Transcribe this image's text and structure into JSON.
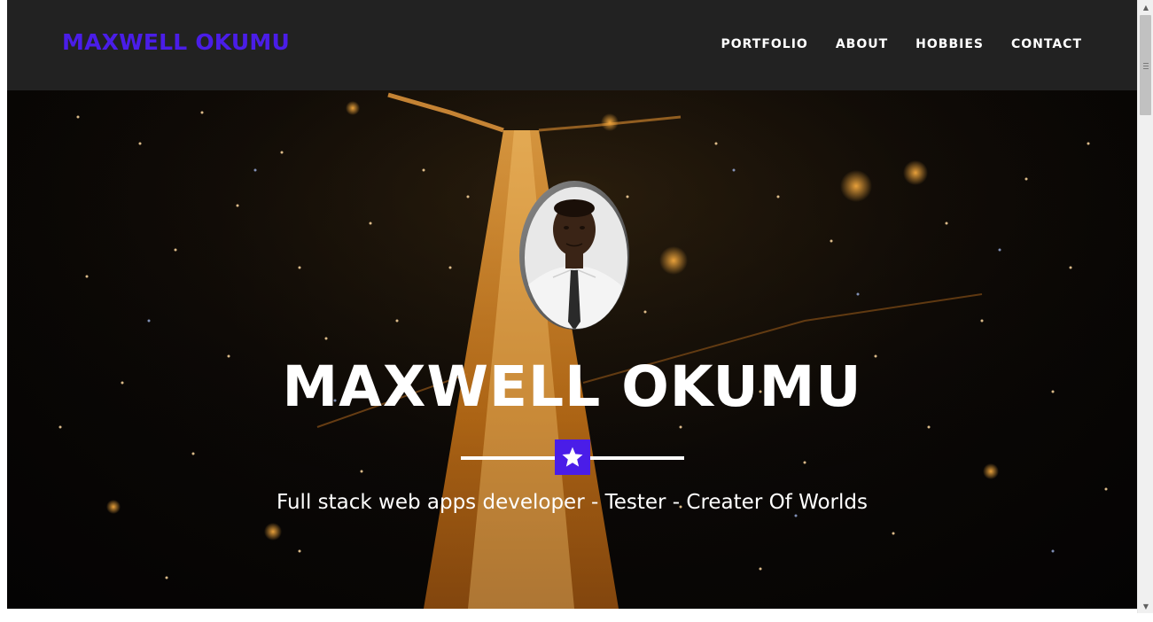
{
  "navbar": {
    "brand": "MAXWELL OKUMU",
    "links": [
      "PORTFOLIO",
      "ABOUT",
      "HOBBIES",
      "CONTACT"
    ]
  },
  "hero": {
    "title": "MAXWELL OKUMU",
    "subtitle": "Full stack web apps developer - Tester - Creater Of Worlds",
    "divider_icon": "star-icon",
    "avatar_icon": "profile-photo"
  },
  "colors": {
    "accent": "#4a1de8",
    "navbar_bg": "#222222",
    "text": "#ffffff"
  }
}
